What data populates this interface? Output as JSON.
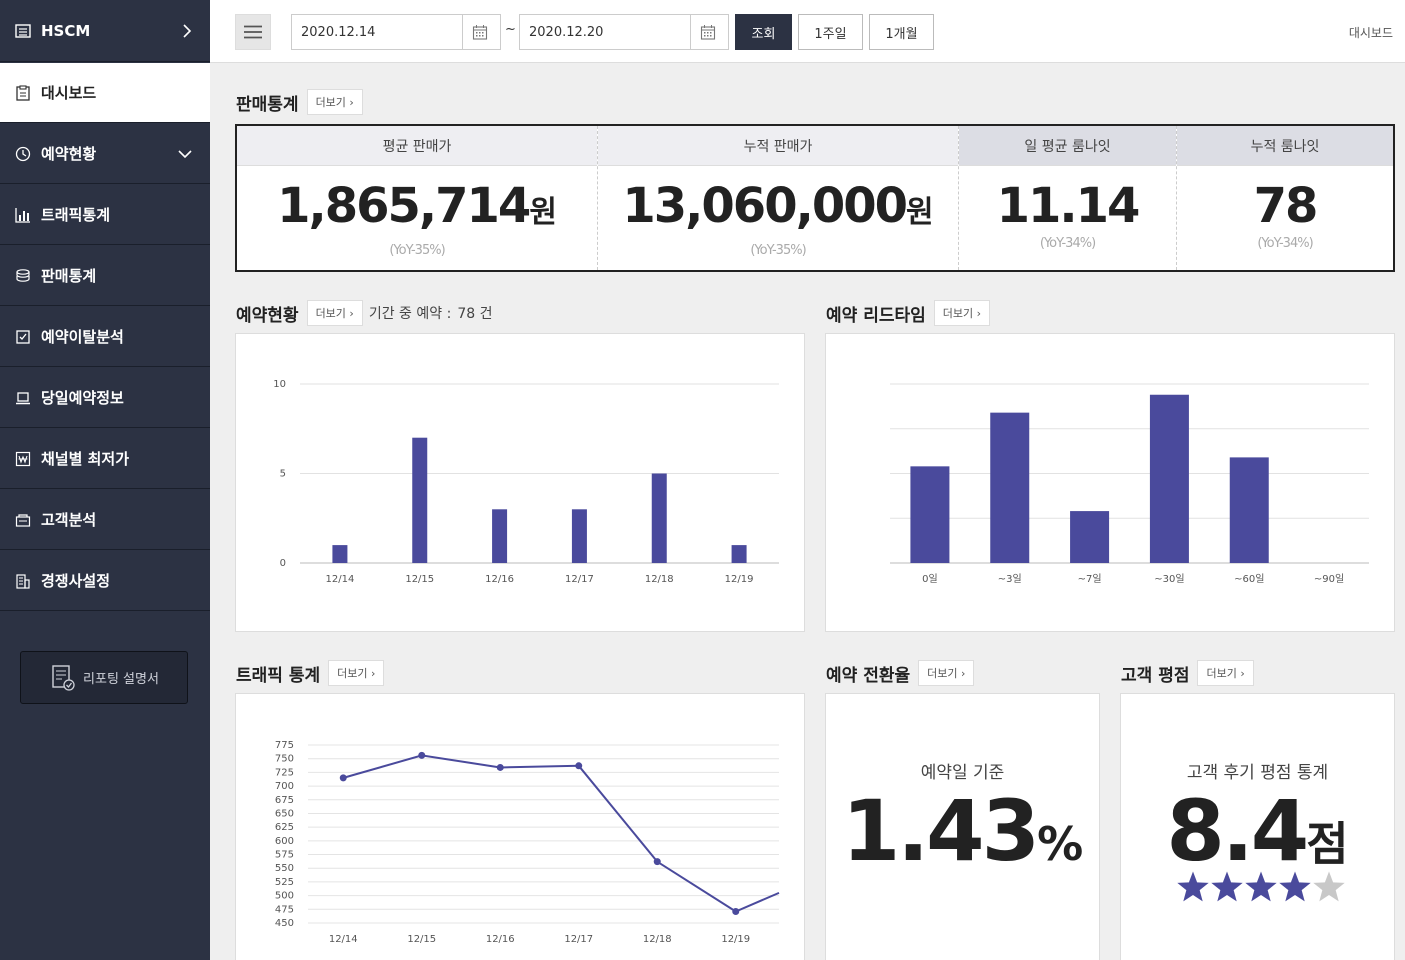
{
  "sidebar": {
    "brand": "HSCM",
    "items": [
      {
        "label": "대시보드",
        "icon": "clipboard-icon"
      },
      {
        "label": "예약현황",
        "icon": "clock-icon"
      },
      {
        "label": "트래픽통계",
        "icon": "bar-chart-icon"
      },
      {
        "label": "판매통계",
        "icon": "coins-icon"
      },
      {
        "label": "예약이탈분석",
        "icon": "checklist-icon"
      },
      {
        "label": "당일예약정보",
        "icon": "laptop-icon"
      },
      {
        "label": "채널별 최저가",
        "icon": "won-icon"
      },
      {
        "label": "고객분석",
        "icon": "customer-icon"
      },
      {
        "label": "경쟁사설정",
        "icon": "building-icon"
      }
    ],
    "doc_button": "리포팅 설명서"
  },
  "header": {
    "start_date": "2020.12.14",
    "separator": "~",
    "end_date": "2020.12.20",
    "search_label": "조회",
    "week_label": "1주일",
    "month_label": "1개월",
    "breadcrumb": "대시보드"
  },
  "more_label": "더보기",
  "sales": {
    "title": "판매통계",
    "cols": [
      {
        "label": "평균 판매가",
        "value": "1,865,714",
        "unit": "원",
        "yoy": "(YoY-35%)"
      },
      {
        "label": "누적 판매가",
        "value": "13,060,000",
        "unit": "원",
        "yoy": "(YoY-35%)"
      },
      {
        "label": "일 평균 룸나잇",
        "value": "11.14",
        "unit": "",
        "yoy": "(YoY-34%)"
      },
      {
        "label": "누적 룸나잇",
        "value": "78",
        "unit": "",
        "yoy": "(YoY-34%)"
      }
    ]
  },
  "reservation": {
    "title": "예약현황",
    "note_label": "기간 중 예약 :",
    "note_value": "78 건"
  },
  "leadtime": {
    "title": "예약 리드타임"
  },
  "traffic": {
    "title": "트래픽 통계"
  },
  "conversion": {
    "title": "예약 전환율",
    "label": "예약일 기준",
    "value": "1.43",
    "unit": "%"
  },
  "rating": {
    "title": "고객 평점",
    "label": "고객 후기 평점 통계",
    "value": "8.4",
    "unit": "점",
    "stars": 4,
    "max_stars": 5,
    "star_color": "#4a4a9c"
  },
  "colors": {
    "accent": "#4a4a9c",
    "sidebar": "#2c3243"
  },
  "chart_data": [
    {
      "type": "bar",
      "categories": [
        "12/14",
        "12/15",
        "12/16",
        "12/17",
        "12/18",
        "12/19"
      ],
      "values": [
        1,
        7,
        3,
        3,
        5,
        1
      ],
      "yticks": [
        0,
        5,
        10
      ],
      "ylim": [
        0,
        10
      ],
      "grid": true
    },
    {
      "type": "bar",
      "categories": [
        "0일",
        "~3일",
        "~7일",
        "~30일",
        "~60일",
        "~90일"
      ],
      "values": [
        5.4,
        8.4,
        2.9,
        9.4,
        5.9,
        0
      ],
      "ylim": [
        0,
        10
      ],
      "grid": true
    },
    {
      "type": "line",
      "categories": [
        "12/14",
        "12/15",
        "12/16",
        "12/17",
        "12/18",
        "12/19"
      ],
      "values": [
        715,
        756,
        734,
        737,
        562,
        471
      ],
      "tail_value": 505,
      "yticks": [
        450,
        475,
        500,
        525,
        550,
        575,
        600,
        625,
        650,
        675,
        700,
        725,
        750,
        775
      ],
      "ylim": [
        450,
        775
      ],
      "grid": true
    }
  ]
}
